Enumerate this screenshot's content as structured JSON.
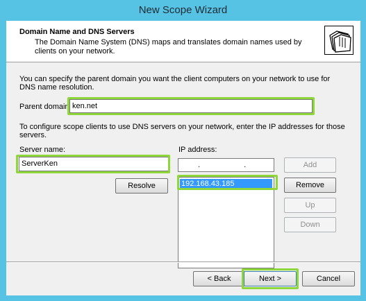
{
  "window": {
    "title": "New Scope Wizard"
  },
  "header": {
    "title": "Domain Name and DNS Servers",
    "description": "The Domain Name System (DNS) maps and translates domain names used by clients on your network."
  },
  "body": {
    "intro_text": "You can specify the parent domain you want the client computers on your network to use for DNS name resolution.",
    "parent_domain_label": "Parent domain:",
    "parent_domain_value": "ken.net",
    "dns_intro_text": "To configure scope clients to use DNS servers on your network, enter the IP addresses for those servers.",
    "server_name_label": "Server name:",
    "server_name_value": "ServerKen",
    "ip_address_label": "IP address:",
    "ip_address_value": ". . .",
    "resolve_button": "Resolve",
    "add_button": "Add",
    "remove_button": "Remove",
    "up_button": "Up",
    "down_button": "Down",
    "dns_servers": [
      "192.168.43.185"
    ]
  },
  "footer": {
    "back_button": "< Back",
    "next_button": "Next >",
    "cancel_button": "Cancel"
  },
  "icons": {
    "header_icon": "folders-icon"
  },
  "colors": {
    "highlight": "#8fd63a",
    "title_bar": "#56c3e4",
    "selection": "#3399ff"
  }
}
